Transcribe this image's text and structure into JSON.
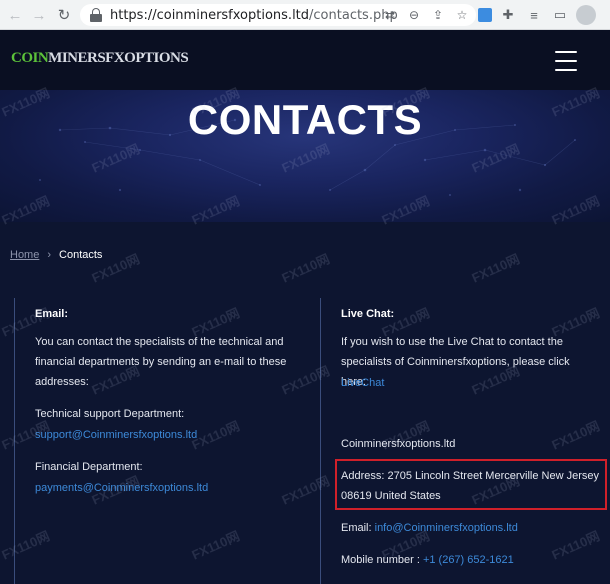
{
  "browser": {
    "url_host": "https://coinminersfxoptions.ltd",
    "url_path": "/contacts.php",
    "back_icon": "back-arrow-icon",
    "forward_icon": "forward-arrow-icon",
    "reload_icon": "reload-icon"
  },
  "site": {
    "logo_colored": "COIN",
    "logo_rest": "MINERSFXOPTIONS",
    "logo_color": "#5cc23a"
  },
  "hero": {
    "title": "CONTACTS"
  },
  "breadcrumb": {
    "home": "Home",
    "separator": "›",
    "current": "Contacts"
  },
  "email_section": {
    "title": "Email:",
    "description": "You can contact the specialists of the technical and financial departments by sending an e-mail to these addresses:",
    "tech_label": "Technical support Department:",
    "tech_email": "support@Coinminersfxoptions.ltd",
    "fin_label": "Financial Department:",
    "fin_email": "payments@Coinminersfxoptions.ltd"
  },
  "chat_section": {
    "title": "Live Chat:",
    "description": "If you wish to use the Live Chat to contact the specialists of Coinminersfxoptions, please click here:",
    "link": "LiveChat",
    "company": "Coinminersfxoptions.ltd",
    "address": "Address: 2705 Lincoln Street Mercerville New Jersey 08619 United States",
    "email_label": "Email:",
    "email": "info@Coinminersfxoptions.ltd",
    "mobile_label": "Mobile number :",
    "mobile": "+1 (267) 652-1621"
  },
  "watermark": "FX110网",
  "colors": {
    "background": "#0d1530",
    "link": "#3d8ad9",
    "highlight_border": "#d0202a"
  }
}
